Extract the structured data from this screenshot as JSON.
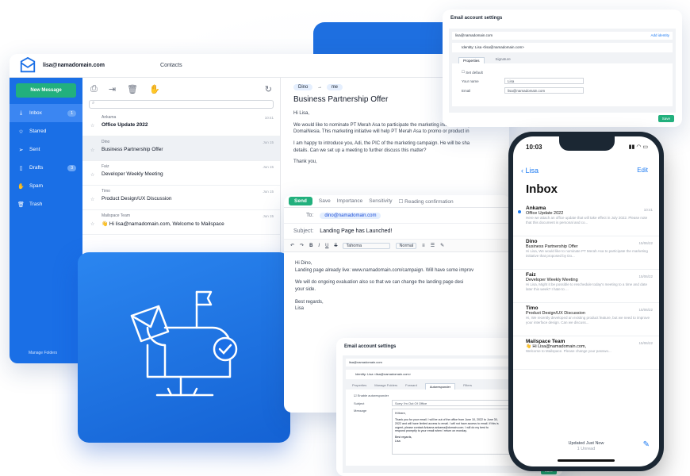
{
  "main": {
    "account": "lisa@namadomain.com",
    "contacts_label": "Contacts",
    "new_message_label": "New Message",
    "folders": [
      {
        "label": "Inbox",
        "badge": "1"
      },
      {
        "label": "Starred",
        "badge": ""
      },
      {
        "label": "Sent",
        "badge": ""
      },
      {
        "label": "Drafts",
        "badge": "3"
      },
      {
        "label": "Spam",
        "badge": ""
      },
      {
        "label": "Trash",
        "badge": ""
      }
    ],
    "manage_folders_label": "Manage Folders",
    "messages": [
      {
        "from": "Ankama",
        "subject": "Office Update 2022",
        "date": "10:41"
      },
      {
        "from": "Dino",
        "subject": "Business Partnership Offer",
        "date": "Jun 15"
      },
      {
        "from": "Faiz",
        "subject": "Developer Weekly Meeting",
        "date": "Jun 15"
      },
      {
        "from": "Timo",
        "subject": "Product Design/UX Discussion",
        "date": "Jun 15"
      },
      {
        "from": "Mailspace Team",
        "subject": "👋 Hi lisa@namadomain.com, Welcome to Mailspace",
        "date": "Jun 15"
      }
    ]
  },
  "reader": {
    "from_chip": "Dino",
    "to_chip": "me",
    "subject": "Business Partnership Offer",
    "greeting": "Hi Lisa,",
    "p1a": "We would like to nominate PT Merah Asa to participate the marketing initiative that pro",
    "p1b": "DomaiNesia. This marketing initiative will help PT Merah Asa to promo or product in",
    "p2a": "I am happy to introduce you, Adi, the PIC of the marketing campaign. He will be sha",
    "p2b": "details. Can we set up a meeting to further discuss this matter?",
    "thanks": "Thank you,"
  },
  "compose": {
    "send_label": "Send",
    "save_label": "Save",
    "importance_label": "Importance",
    "sensitivity_label": "Sensitivity",
    "reading_confirmation_label": "Reading confirmation",
    "to_label": "To:",
    "to_value": "dino@namadomain.com",
    "subject_label": "Subject:",
    "subject_value": "Landing Page has Launched!",
    "font_value": "Tahoma",
    "size_value": "Normal",
    "body1": "Hi Dino,",
    "body2": "Landing page already live: www.namadomain.com/campaign. Will have some improv",
    "body3": "We will do ongoing evaluation also so that we can change the landing page desi",
    "body4": "your side.",
    "body5": "Best regards,",
    "body6": "Lisa"
  },
  "settings_top": {
    "title": "Email account settings",
    "email": "lisa@namadomain.com",
    "identity": "Identity: Lisa <lisa@namadomain.com>",
    "add_identity": "Add identity",
    "tabs": [
      "Properties",
      "Signature"
    ],
    "set_default": "Set default",
    "name_label": "Your name",
    "name_value": "Lisa",
    "email_label": "Email",
    "email_value": "lisa@namadomain.com",
    "save_label": "Save"
  },
  "settings_bottom": {
    "title": "Email account settings",
    "email": "lisa@namadomain.com",
    "add_identity": "Add identity",
    "identity": "Identity: Lisa <lisa@namadomain.com>",
    "tabs": [
      "Properties",
      "Manage Folders",
      "Forward",
      "Autoresponder",
      "Filters"
    ],
    "enable_label": "Enable autoresponder",
    "subject_label": "Subject",
    "subject_value": "Sorry I'm Out Of Office",
    "message_label": "Message",
    "msg1": "Hi there,",
    "msg2": "Thank you for your email. I will be out of the office from June 10, 2022 to June 30,",
    "msg3": "2022 and will have limited access to email. I will not have access to email. If this is",
    "msg4": "urgent, please contact Ankama ankama@domain.com. I will do my best to",
    "msg5": "respond promptly to your email when I return on monday.",
    "msg6": "Best regards,",
    "msg7": "Lisa",
    "save_label": "Save"
  },
  "phone": {
    "time": "10:03",
    "back_label": "Lisa",
    "edit_label": "Edit",
    "title": "Inbox",
    "items": [
      {
        "from": "Ankama",
        "subject": "Office Update 2022",
        "preview": "Here we attach an office update that will take effect in July 2022. Please note that this document is personal and co...",
        "date": "10:41"
      },
      {
        "from": "Dino",
        "subject": "Business Partnership Offer",
        "preview": "Hi Lisa, We would like to nominate PT Merah Asa to participate the marketing initiative that proposed by Do...",
        "date": "15/06/22"
      },
      {
        "from": "Faiz",
        "subject": "Developer Weekly Meeting",
        "preview": "Hi Lisa, Might it be possible to reschedule today's meeting to a time and date later this week? I hate to ...",
        "date": "15/06/22"
      },
      {
        "from": "Timo",
        "subject": "Product Design/UX Discussion",
        "preview": "Hi, We recently developed an existing product feature, but we need to improve your interface design. Can we discuss...",
        "date": "15/06/22"
      },
      {
        "from": "Mailspace Team",
        "subject": "👋 Hi Lisa@namadomain.com,",
        "preview": "Welcome to Mailspace. Please change your passwo...",
        "date": "15/06/22"
      }
    ],
    "updated_label": "Updated Just Now",
    "unread_label": "1 Unread"
  }
}
